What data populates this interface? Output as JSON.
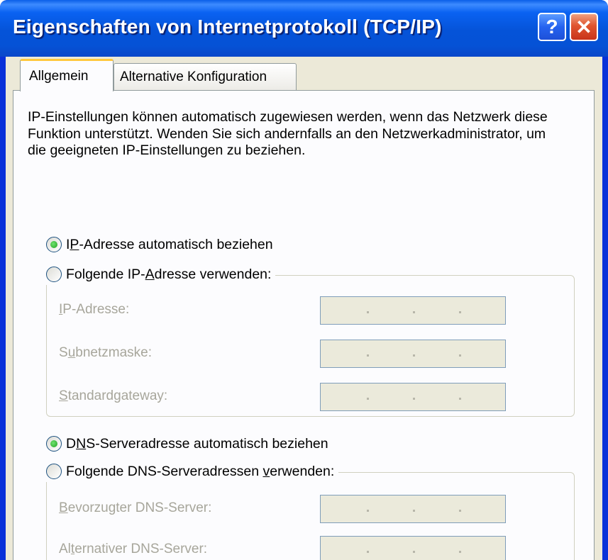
{
  "window": {
    "title": "Eigenschaften von Internetprotokoll (TCP/IP)",
    "help_symbol": "?",
    "close_symbol": "✕"
  },
  "tabs": [
    {
      "label": "Allgemein",
      "active": true
    },
    {
      "label": "Alternative Konfiguration",
      "active": false
    }
  ],
  "description": "IP-Einstellungen können automatisch zugewiesen werden, wenn das Netzwerk diese Funktion unterstützt. Wenden Sie sich andernfalls an den Netzwerkadministrator, um die geeigneten IP-Einstellungen zu beziehen.",
  "ip_section": {
    "auto_option": {
      "pre": "I",
      "accel": "P",
      "post": "-Adresse automatisch beziehen",
      "selected": true
    },
    "manual_option": {
      "pre": "Folgende IP-",
      "accel": "A",
      "post": "dresse verwenden:",
      "selected": false
    },
    "fields": [
      {
        "pre": "",
        "accel": "I",
        "post": "P-Adresse:",
        "value": ""
      },
      {
        "pre": "S",
        "accel": "u",
        "post": "bnetzmaske:",
        "value": ""
      },
      {
        "pre": "",
        "accel": "S",
        "post": "tandardgateway:",
        "value": ""
      }
    ]
  },
  "dns_section": {
    "auto_option": {
      "pre": "D",
      "accel": "N",
      "post": "S-Serveradresse automatisch beziehen",
      "selected": true
    },
    "manual_option": {
      "pre": "Folgende DNS-Serveradressen ",
      "accel": "v",
      "post": "erwenden:",
      "selected": false
    },
    "fields": [
      {
        "pre": "",
        "accel": "B",
        "post": "evorzugter DNS-Server:",
        "value": ""
      },
      {
        "pre": "Al",
        "accel": "t",
        "post": "ernativer DNS-Server:",
        "value": ""
      }
    ]
  },
  "colors": {
    "titlebar": "#0553d8",
    "dialog_bg": "#ece9d8",
    "active_tab_accent": "#ffc83c",
    "disabled_text": "#a7a69b",
    "disabled_field": "#ebeadb"
  }
}
